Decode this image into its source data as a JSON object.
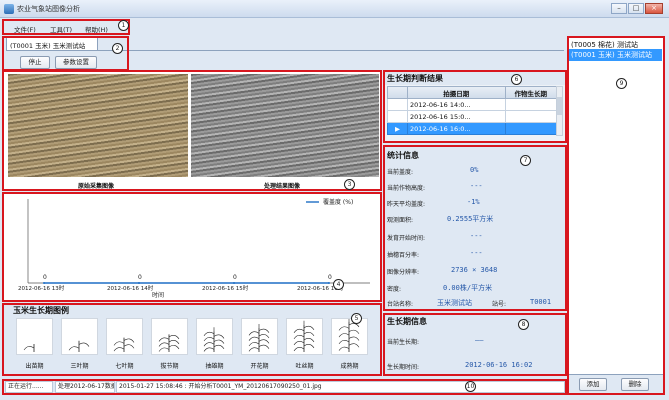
{
  "window": {
    "title": "农业气象站图像分析",
    "min": "–",
    "restore": "□",
    "close": "×"
  },
  "menu": [
    "文件(F)",
    "工具(T)",
    "帮助(H)"
  ],
  "tab": {
    "label": "(T0001 玉米) 玉米测试站"
  },
  "toolbar": {
    "stop": "停止",
    "params": "参数设置"
  },
  "images": {
    "raw_caption": "原始采集图像",
    "processed_caption": "处理结果图像"
  },
  "chart_data": {
    "type": "line",
    "legend": [
      "覆盖度 (%)"
    ],
    "xlabel": "时间",
    "categories": [
      "2012-06-16 13时",
      "2012-06-16 14时",
      "2012-06-16 15时",
      "2012-06-16 16时"
    ],
    "series": [
      {
        "name": "覆盖度 (%)",
        "values": [
          0,
          0,
          0,
          0
        ]
      }
    ],
    "data_labels": [
      "0",
      "0",
      "0",
      "0"
    ],
    "color": "#1f6fc5"
  },
  "stages": {
    "title": "玉米生长期图例",
    "items": [
      "出苗期",
      "三叶期",
      "七叶期",
      "拔节期",
      "抽雄期",
      "开花期",
      "吐丝期",
      "成熟期"
    ]
  },
  "judge": {
    "title": "生长期判断结果",
    "headers": [
      "拍摄日期",
      "作物生长期"
    ],
    "rows": [
      {
        "date": "2012-06-16 14:0...",
        "stage": ""
      },
      {
        "date": "2012-06-16 15:0...",
        "stage": ""
      },
      {
        "date": "2012-06-16 16:0...",
        "stage": ""
      }
    ]
  },
  "stats": {
    "title": "统计信息",
    "coverage_label": "当前盖度:",
    "coverage": "0%",
    "height_label": "当前作物高度:",
    "height": "---",
    "avg_label": "昨天平均盖度:",
    "avg": "-1%",
    "area_label": "观测面积:",
    "area": "0.2555平方米",
    "dev_label": "发育开始时间:",
    "dev": "---",
    "heading_label": "抽穗百分率:",
    "heading": "---",
    "res_label": "图像分辨率:",
    "res": "2736 × 3648",
    "density_label": "密度:",
    "density": "0.00株/平方米",
    "station_label": "台站名称:",
    "station": "玉米测试站",
    "code_label": "站号:",
    "code": "T0001"
  },
  "growth": {
    "title": "生长期信息",
    "current_label": "当前生长期:",
    "current": "——",
    "time_label": "生长期时间:",
    "time": "2012-06-16 16:02"
  },
  "stations": {
    "items": [
      "(T0005 棉花) 测试站",
      "(T0001 玉米) 玉米测试站"
    ],
    "add": "添加",
    "delete": "删除"
  },
  "status": {
    "running": "正在运行......",
    "processing": "处理2012-06-17数据",
    "log": "2015-01-27 15:08:46 : 开始分析T0001_YM_20120617090250_01.jpg"
  },
  "markers": [
    "1",
    "2",
    "3",
    "4",
    "5",
    "6",
    "7",
    "8",
    "9",
    "10"
  ],
  "colors": {
    "accent": "#3399ff",
    "highlight": "#d8161e",
    "value": "#2457a8"
  }
}
